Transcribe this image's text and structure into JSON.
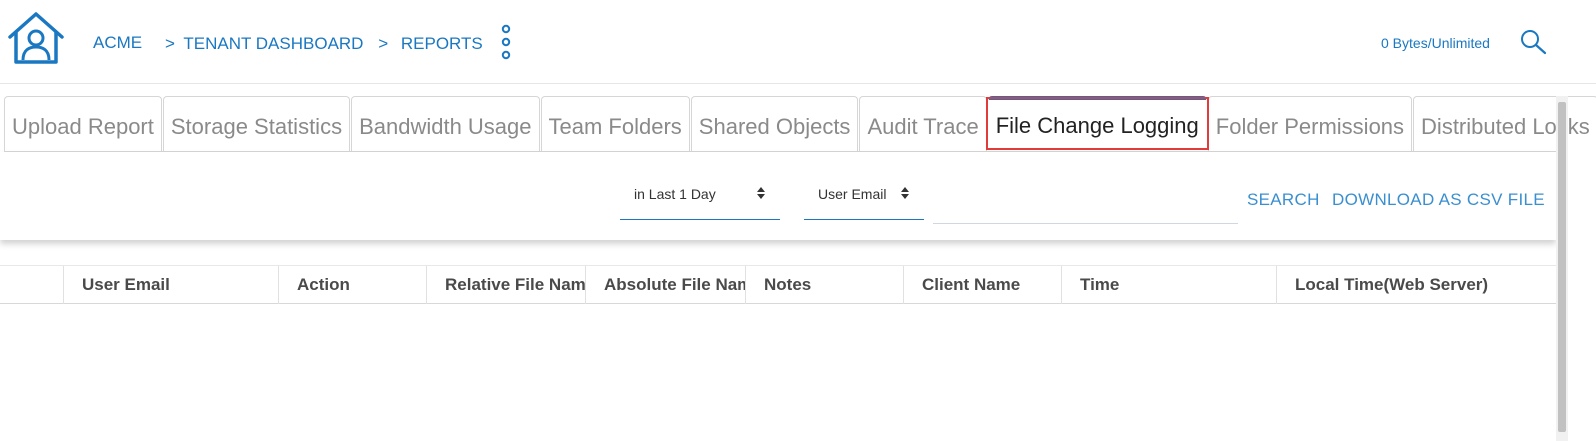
{
  "header": {
    "brand": "ACME",
    "breadcrumb": [
      {
        "sep": ">",
        "label": "TENANT DASHBOARD"
      },
      {
        "sep": ">",
        "label": "REPORTS"
      }
    ],
    "usage": "0 Bytes/Unlimited",
    "icons": {
      "home": "home-user-icon",
      "menu": "vertical-dots-icon",
      "search": "search-icon"
    }
  },
  "tabs": [
    {
      "label": "Upload Report",
      "active": false
    },
    {
      "label": "Storage Statistics",
      "active": false
    },
    {
      "label": "Bandwidth Usage",
      "active": false
    },
    {
      "label": "Team Folders",
      "active": false
    },
    {
      "label": "Shared Objects",
      "active": false
    },
    {
      "label": "Audit Trace",
      "active": false
    },
    {
      "label": "File Change Logging",
      "active": true
    },
    {
      "label": "Folder Permissions",
      "active": false
    },
    {
      "label": "Distributed Locks",
      "active": false
    }
  ],
  "filters": {
    "time_range": "in Last 1 Day",
    "field": "User Email",
    "query_value": "",
    "search_label": "SEARCH",
    "download_label": "DOWNLOAD AS CSV FILE"
  },
  "table": {
    "columns": [
      "",
      "User Email",
      "Action",
      "Relative File Name",
      "Absolute File Name",
      "Notes",
      "Client Name",
      "Time",
      "Local Time(Web Server)"
    ],
    "rows": []
  },
  "colors": {
    "accent": "#1a78c2",
    "highlight_box": "#e23b3b"
  }
}
